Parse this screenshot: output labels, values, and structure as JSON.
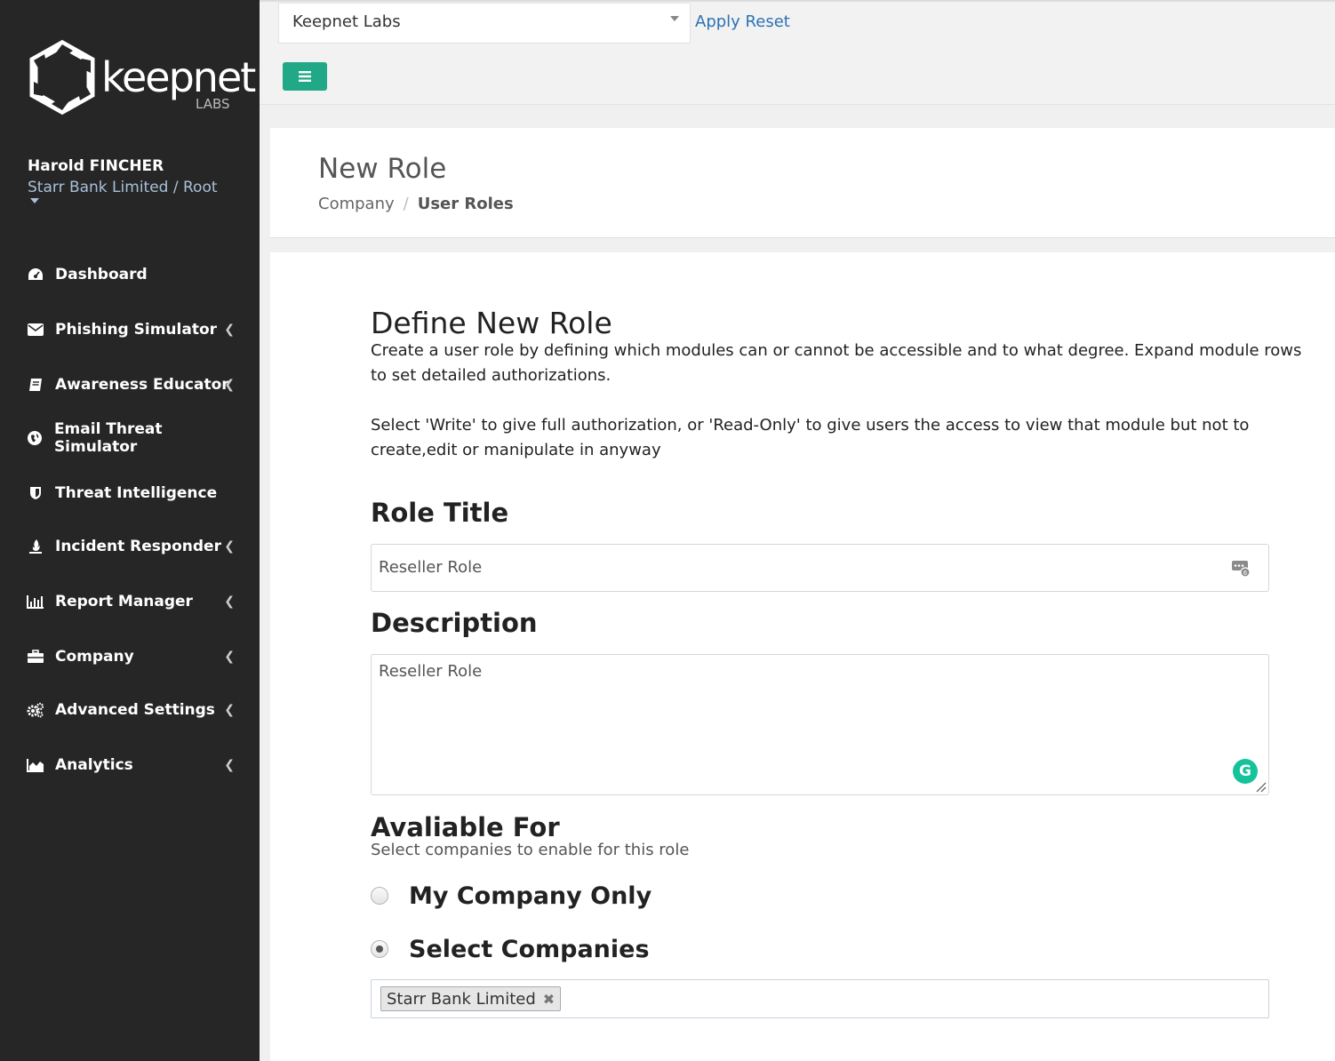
{
  "brand": {
    "name": "keepnet",
    "sub": "LABS"
  },
  "user": {
    "name": "Harold FINCHER",
    "org": "Starr Bank Limited / Root"
  },
  "nav": [
    {
      "label": "Dashboard",
      "icon": "dashboard-icon",
      "has_children": false
    },
    {
      "label": "Phishing Simulator",
      "icon": "envelope-icon",
      "has_children": true
    },
    {
      "label": "Awareness Educator",
      "icon": "book-icon",
      "has_children": true
    },
    {
      "label": "Email Threat Simulator",
      "icon": "globe-icon",
      "has_children": false
    },
    {
      "label": "Threat Intelligence",
      "icon": "shield-icon",
      "has_children": false
    },
    {
      "label": "Incident Responder",
      "icon": "fire-icon",
      "has_children": true
    },
    {
      "label": "Report Manager",
      "icon": "bar-chart-icon",
      "has_children": true
    },
    {
      "label": "Company",
      "icon": "briefcase-icon",
      "has_children": true
    },
    {
      "label": "Advanced Settings",
      "icon": "cogs-icon",
      "has_children": true
    },
    {
      "label": "Analytics",
      "icon": "area-chart-icon",
      "has_children": true
    }
  ],
  "topbar": {
    "company_select": "Keepnet Labs",
    "apply_reset": "Apply Reset"
  },
  "header": {
    "title": "New Role",
    "breadcrumb": [
      "Company",
      "User Roles"
    ]
  },
  "form": {
    "heading": "Define New Role",
    "intro": "Create a user role by defining which modules can or cannot be accessible and to what degree. Expand module rows to set detailed authorizations.",
    "intro2": "Select 'Write' to give full authorization, or 'Read-Only' to give users the access to view that module but not to create,edit or manipulate in anyway",
    "role_title_label": "Role Title",
    "role_title_value": "Reseller Role",
    "description_label": "Description",
    "description_value": "Reseller Role",
    "available_label": "Avaliable For",
    "available_note": "Select companies to enable for this role",
    "options": [
      {
        "label": "My Company Only",
        "checked": false
      },
      {
        "label": "Select Companies",
        "checked": true
      }
    ],
    "selected_companies": [
      "Starr Bank Limited"
    ]
  },
  "colors": {
    "sidebar": "#262626",
    "accent": "#21a886",
    "link": "#2a73b5"
  }
}
